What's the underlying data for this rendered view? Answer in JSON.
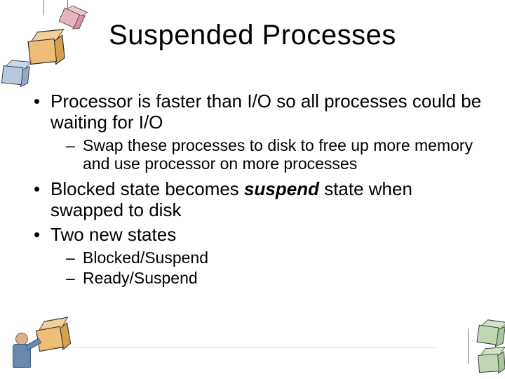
{
  "title": "Suspended Processes",
  "bullets": {
    "b1": "Processor is faster than I/O so all processes could be waiting for I/O",
    "b1_sub1": "Swap these processes to disk to free up more memory and use processor on more processes",
    "b2_pre": "Blocked state becomes ",
    "b2_em": "suspend",
    "b2_post": " state when swapped to disk",
    "b3": "Two new states",
    "b3_sub1": "Blocked/Suspend",
    "b3_sub2": "Ready/Suspend"
  }
}
